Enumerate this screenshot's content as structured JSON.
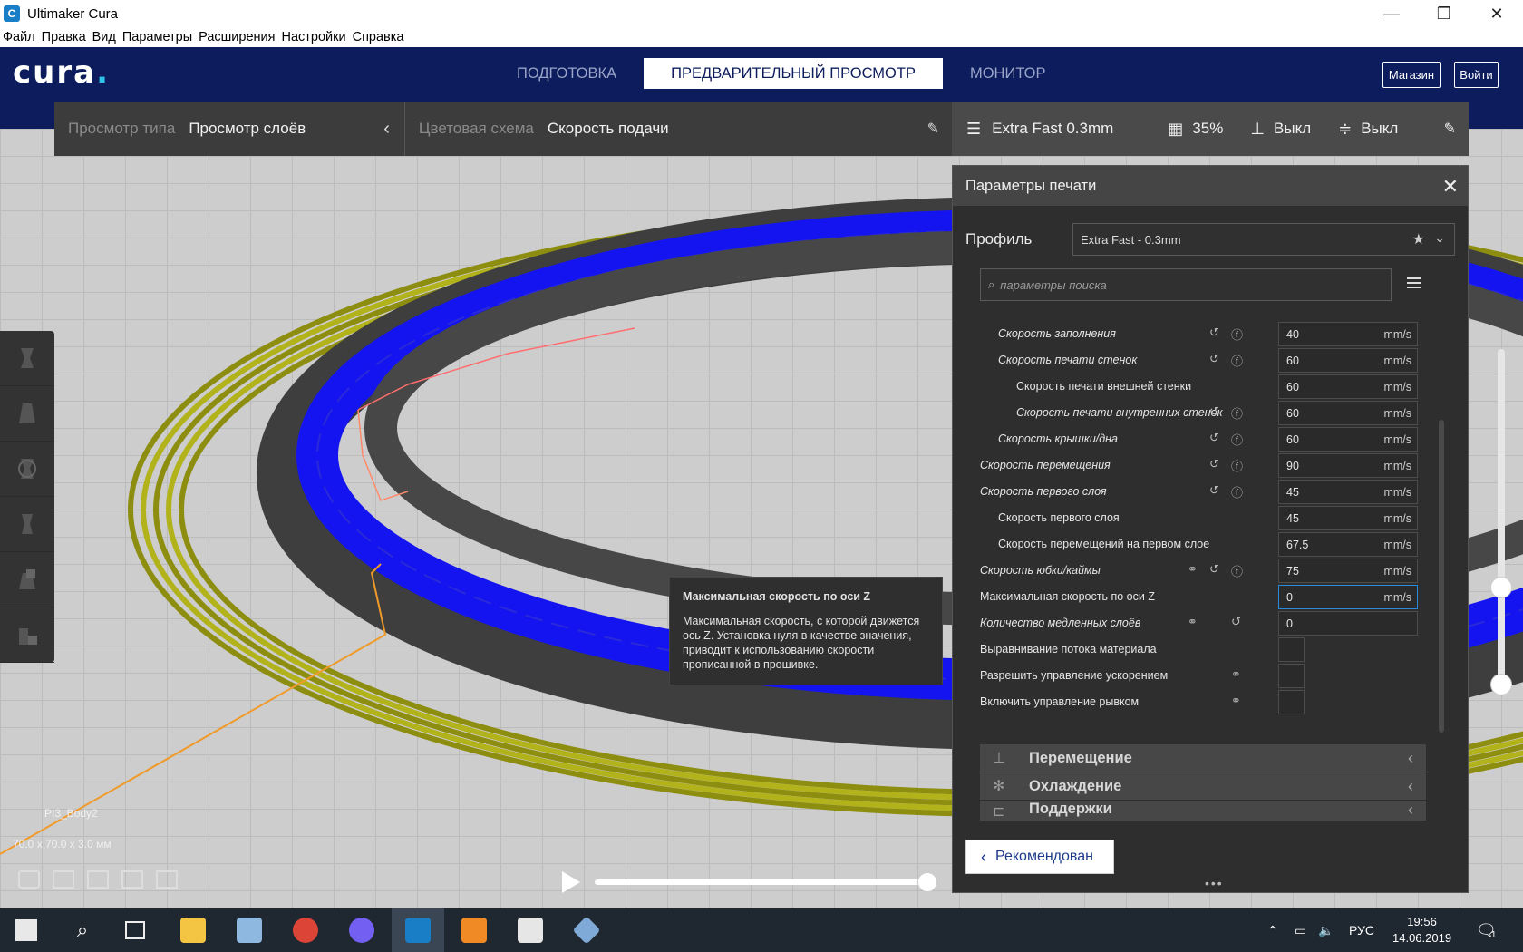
{
  "window": {
    "title": "Ultimaker Cura",
    "icon": "cura-app-icon",
    "controls": [
      "—",
      "❐",
      "✕"
    ]
  },
  "menu": [
    "Файл",
    "Правка",
    "Вид",
    "Параметры",
    "Расширения",
    "Настройки",
    "Справка"
  ],
  "header": {
    "logo": "cura",
    "stages": [
      "ПОДГОТОВКА",
      "ПРЕДВАРИТЕЛЬНЫЙ ПРОСМОТР",
      "МОНИТОР"
    ],
    "active_stage": 1,
    "marketplace": "Магазин",
    "signin": "Войти"
  },
  "viewbar": {
    "view_type_label": "Просмотр типа",
    "view_type_value": "Просмотр слоёв",
    "color_scheme_label": "Цветовая схема",
    "color_scheme_value": "Скорость подачи"
  },
  "printbar": {
    "profile": "Extra Fast 0.3mm",
    "infill": "35%",
    "support": "Выкл",
    "adhesion": "Выкл"
  },
  "panel": {
    "title": "Параметры печати",
    "profile_label": "Профиль",
    "profile_value": "Extra Fast - 0.3mm",
    "search_placeholder": "параметры поиска",
    "recommended_button": "Рекомендован"
  },
  "settings": [
    {
      "name": "Скорость заполнения",
      "indent": 1,
      "italic": true,
      "reset": true,
      "info": true,
      "value": "40",
      "unit": "mm/s"
    },
    {
      "name": "Скорость печати стенок",
      "indent": 1,
      "italic": true,
      "reset": true,
      "info": true,
      "value": "60",
      "unit": "mm/s"
    },
    {
      "name": "Скорость печати внешней стенки",
      "indent": 2,
      "italic": false,
      "value": "60",
      "unit": "mm/s"
    },
    {
      "name": "Скорость печати внутренних стенок",
      "indent": 2,
      "italic": true,
      "reset": true,
      "info": true,
      "value": "60",
      "unit": "mm/s"
    },
    {
      "name": "Скорость крышки/дна",
      "indent": 1,
      "italic": true,
      "reset": true,
      "info": true,
      "value": "60",
      "unit": "mm/s"
    },
    {
      "name": "Скорость перемещения",
      "indent": 0,
      "italic": true,
      "reset": true,
      "info": true,
      "value": "90",
      "unit": "mm/s"
    },
    {
      "name": "Скорость первого слоя",
      "indent": 0,
      "italic": true,
      "reset": true,
      "info": true,
      "value": "45",
      "unit": "mm/s"
    },
    {
      "name": "Скорость первого слоя",
      "indent": 1,
      "italic": false,
      "value": "45",
      "unit": "mm/s"
    },
    {
      "name": "Скорость перемещений на первом слое",
      "indent": 1,
      "italic": false,
      "value": "67.5",
      "unit": "mm/s"
    },
    {
      "name": "Скорость юбки/каймы",
      "indent": 0,
      "italic": true,
      "link": true,
      "reset": true,
      "info": true,
      "value": "75",
      "unit": "mm/s"
    },
    {
      "name": "Максимальная скорость по оси Z",
      "indent": 0,
      "italic": false,
      "value": "0",
      "unit": "mm/s",
      "focused": true
    },
    {
      "name": "Количество медленных слоёв",
      "indent": 0,
      "italic": true,
      "link": true,
      "reset": true,
      "value": "0",
      "unit": ""
    },
    {
      "name": "Выравнивание потока материала",
      "indent": 0,
      "italic": false,
      "checkbox": true
    },
    {
      "name": "Разрешить управление ускорением",
      "indent": 0,
      "italic": false,
      "link": true,
      "checkbox": true
    },
    {
      "name": "Включить управление рывком",
      "indent": 0,
      "italic": false,
      "link": true,
      "checkbox": true
    }
  ],
  "categories": [
    {
      "name": "Перемещение",
      "icon": "travel-icon"
    },
    {
      "name": "Охлаждение",
      "icon": "cooling-fan-icon"
    },
    {
      "name": "Поддержки",
      "icon": "support-icon"
    }
  ],
  "tooltip": {
    "title": "Максимальная скорость по оси Z",
    "body": "Максимальная скорость, с которой движется ось Z. Установка нуля в качестве значения, приводит к использованию скорости прописанной в прошивке."
  },
  "model": {
    "name": "PI3_Body2",
    "dims": "70.0 x 70.0 x 3.0 мм"
  },
  "taskbar": {
    "lang": "РУС",
    "time": "19:56",
    "date": "14.06.2019",
    "notifications": "1"
  },
  "colors": {
    "header": "#0c1c5c",
    "accent": "#2a89d9",
    "layer_blue": "#1414f0",
    "layer_yellow": "#9d9d12",
    "travel": "#f0a030"
  }
}
